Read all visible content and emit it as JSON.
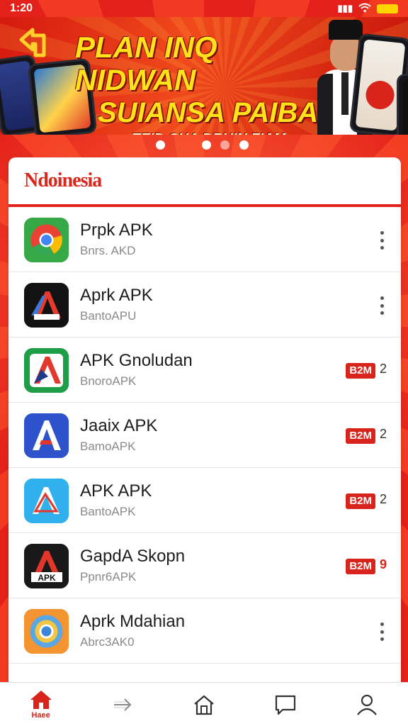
{
  "status_bar": {
    "time": "1:20",
    "signal": "▮▮▮",
    "wifi": "◠"
  },
  "banner": {
    "headline_line1": "PLAN INQ NIDWAN",
    "headline_line2": "SUIANSA PAIBA",
    "headline_line3": "TEID CHA DRUIN ZIAM"
  },
  "carousel": {
    "dot_count": 4,
    "active_index": 0
  },
  "card": {
    "brand": "Ndoinesia"
  },
  "apps": [
    {
      "name": "Prpk APK",
      "sub": "Bnrs. AKD",
      "icon": "chrome-like-icon",
      "action": "kebab"
    },
    {
      "name": "Aprk APK",
      "sub": "BantoAPU",
      "icon": "apk-a-dark-icon",
      "action": "kebab"
    },
    {
      "name": "APK Gnoludan",
      "sub": "BnoroAPK",
      "icon": "apk-a-green-icon",
      "action": "badge",
      "badge": "B2M",
      "badge_num": "2"
    },
    {
      "name": "Jaaix APK",
      "sub": "BamoAPK",
      "icon": "apk-a-blue-icon",
      "action": "badge",
      "badge": "B2M",
      "badge_num": "2"
    },
    {
      "name": "APK APK",
      "sub": "BantoAPK",
      "icon": "apk-a-lightblue-icon",
      "action": "badge",
      "badge": "B2M",
      "badge_num": "2"
    },
    {
      "name": "GapdA Skopn",
      "sub": "Ppnr6APK",
      "icon": "apk-a-black-icon",
      "action": "badge",
      "badge": "B2M",
      "badge_num": "9"
    },
    {
      "name": "Aprk Mdahian",
      "sub": "Abrc3AK0",
      "icon": "chrome-orange-icon",
      "action": "kebab"
    }
  ],
  "bottom_nav": [
    {
      "name": "home-active",
      "label": "Haee"
    },
    {
      "name": "forward",
      "label": ""
    },
    {
      "name": "house",
      "label": ""
    },
    {
      "name": "chat",
      "label": ""
    },
    {
      "name": "profile",
      "label": ""
    }
  ],
  "colors": {
    "brand_red": "#e4231c",
    "banner_yellow": "#ffe21a"
  }
}
